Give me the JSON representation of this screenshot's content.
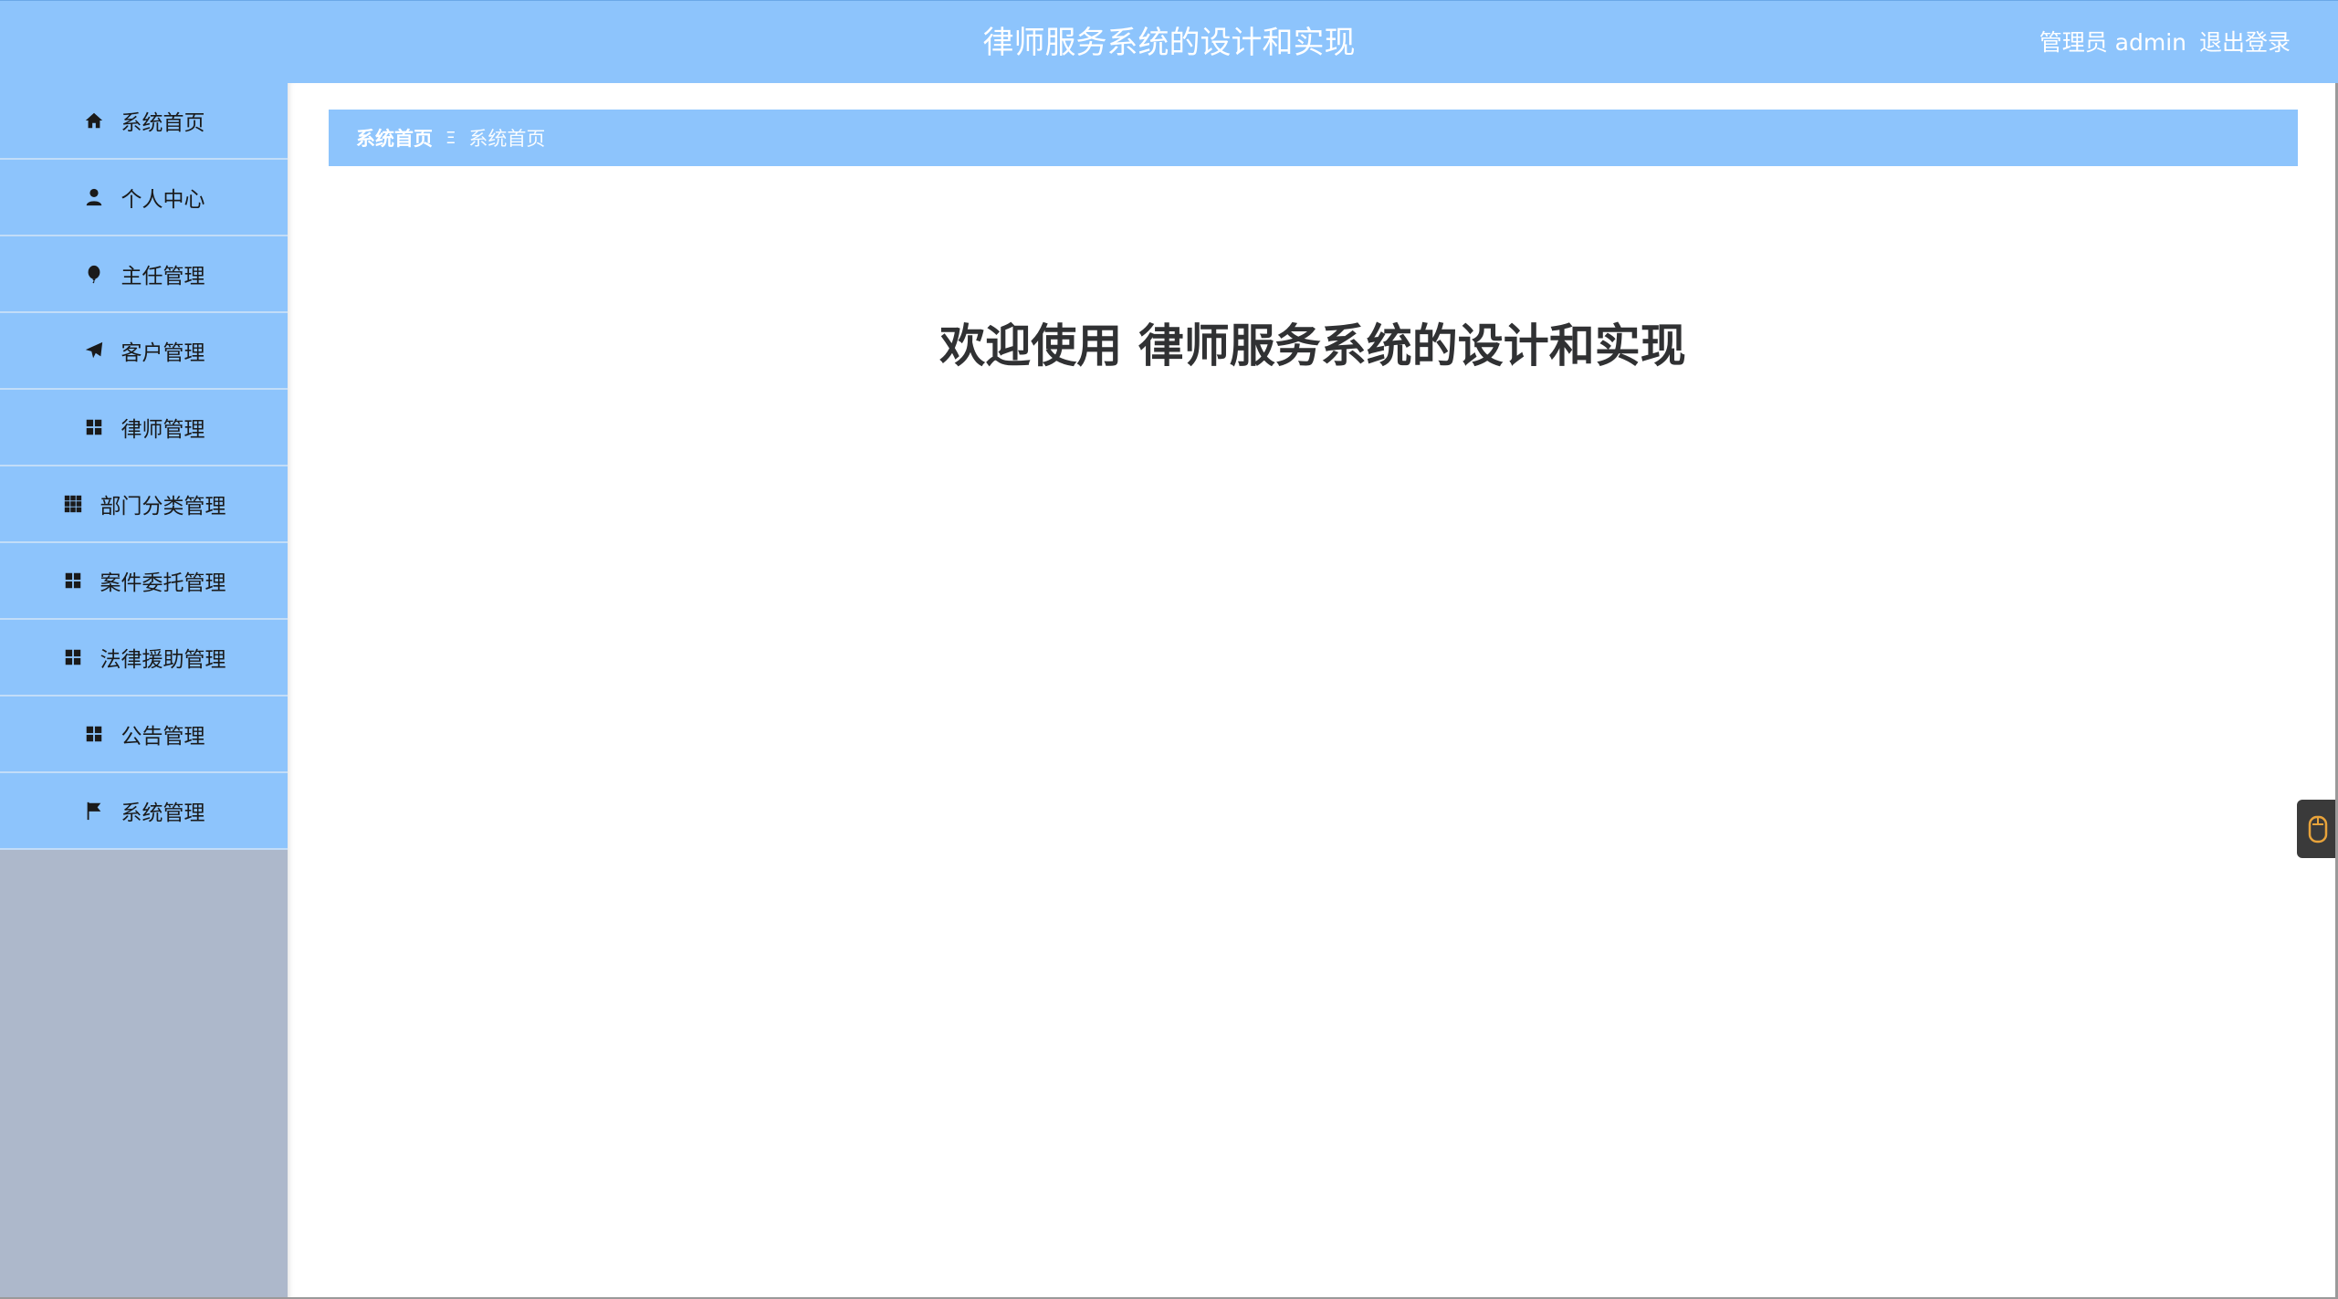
{
  "header": {
    "title": "律师服务系统的设计和实现",
    "user_label": "管理员 admin",
    "logout_label": "退出登录"
  },
  "sidebar": {
    "items": [
      {
        "label": "系统首页",
        "icon": "home-icon"
      },
      {
        "label": "个人中心",
        "icon": "user-icon"
      },
      {
        "label": "主任管理",
        "icon": "balloon-icon"
      },
      {
        "label": "客户管理",
        "icon": "paper-plane-icon"
      },
      {
        "label": "律师管理",
        "icon": "grid-icon"
      },
      {
        "label": "部门分类管理",
        "icon": "grid-nine-icon"
      },
      {
        "label": "案件委托管理",
        "icon": "grid-icon"
      },
      {
        "label": "法律援助管理",
        "icon": "grid-icon"
      },
      {
        "label": "公告管理",
        "icon": "grid-icon"
      },
      {
        "label": "系统管理",
        "icon": "flag-icon"
      }
    ]
  },
  "breadcrumb": {
    "root": "系统首页",
    "separator": "Ξ",
    "current": "系统首页"
  },
  "main": {
    "welcome": "欢迎使用 律师服务系统的设计和实现"
  },
  "colors": {
    "accent": "#8dc4fc",
    "sidebar_bg": "#adb8cb",
    "heading": "#303133"
  }
}
